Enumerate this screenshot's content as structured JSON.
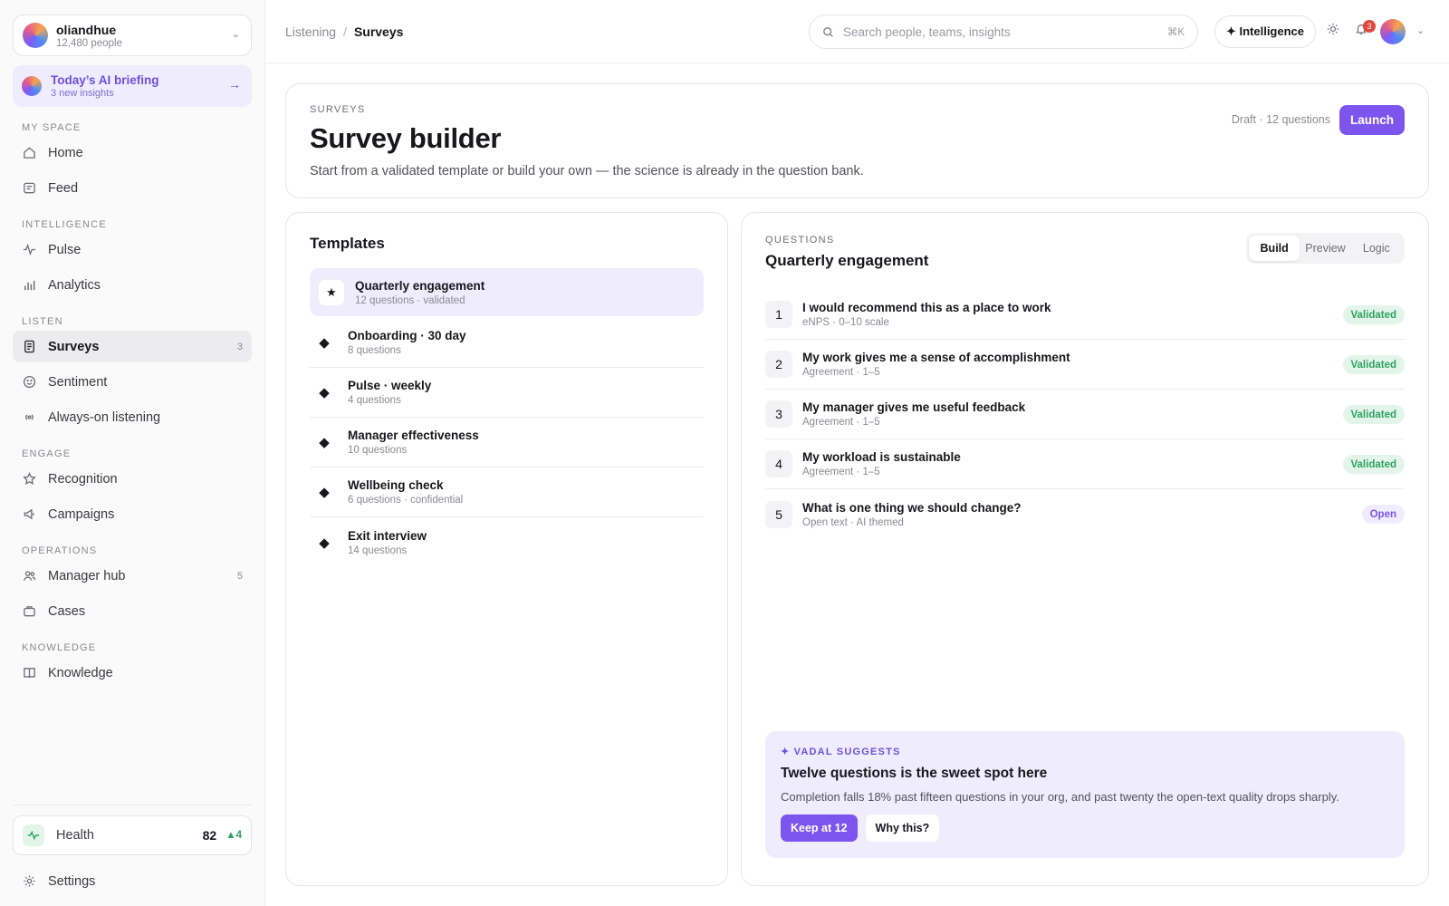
{
  "org": {
    "name": "oliandhue",
    "people": "12,480 people"
  },
  "briefing": {
    "title": "Today’s AI briefing",
    "subtitle": "3 new insights"
  },
  "sidebar": {
    "sections": {
      "myspace": "MY SPACE",
      "intelligence": "INTELLIGENCE",
      "listen": "LISTEN",
      "engage": "ENGAGE",
      "operations": "OPERATIONS",
      "knowledge": "KNOWLEDGE"
    },
    "items": {
      "home": "Home",
      "feed": "Feed",
      "pulse": "Pulse",
      "analytics": "Analytics",
      "surveys": "Surveys",
      "surveys_count": "3",
      "sentiment": "Sentiment",
      "always_on": "Always-on listening",
      "recognition": "Recognition",
      "campaigns": "Campaigns",
      "manager_hub": "Manager hub",
      "manager_hub_count": "5",
      "cases": "Cases",
      "knowledge": "Knowledge"
    },
    "health": {
      "label": "Health",
      "value": "82",
      "delta": "▲4"
    },
    "settings": "Settings"
  },
  "topbar": {
    "breadcrumb": {
      "parent": "Listening",
      "separator": "/",
      "current": "Surveys"
    },
    "search_placeholder": "Search people, teams, insights",
    "search_shortcut": "⌘K",
    "intelligence_button": "✦ Intelligence",
    "notification_count": "3"
  },
  "header": {
    "eyebrow": "SURVEYS",
    "title": "Survey builder",
    "description": "Start from a validated template or build your own — the science is already in the question bank.",
    "meta": "Draft · 12 questions",
    "launch": "Launch"
  },
  "templates": {
    "title": "Templates",
    "items": [
      {
        "icon": "★",
        "name": "Quarterly engagement",
        "sub": "12 questions · validated"
      },
      {
        "icon": "◆",
        "name": "Onboarding · 30 day",
        "sub": "8 questions"
      },
      {
        "icon": "◆",
        "name": "Pulse · weekly",
        "sub": "4 questions"
      },
      {
        "icon": "◆",
        "name": "Manager effectiveness",
        "sub": "10 questions"
      },
      {
        "icon": "◆",
        "name": "Wellbeing check",
        "sub": "6 questions · confidential"
      },
      {
        "icon": "◆",
        "name": "Exit interview",
        "sub": "14 questions"
      }
    ]
  },
  "questions": {
    "eyebrow": "QUESTIONS",
    "title": "Quarterly engagement",
    "tabs": [
      "Build",
      "Preview",
      "Logic"
    ],
    "items": [
      {
        "n": "1",
        "text": "I would recommend this as a place to work",
        "sub": "eNPS · 0–10 scale",
        "tag": "Validated"
      },
      {
        "n": "2",
        "text": "My work gives me a sense of accomplishment",
        "sub": "Agreement · 1–5",
        "tag": "Validated"
      },
      {
        "n": "3",
        "text": "My manager gives me useful feedback",
        "sub": "Agreement · 1–5",
        "tag": "Validated"
      },
      {
        "n": "4",
        "text": "My workload is sustainable",
        "sub": "Agreement · 1–5",
        "tag": "Validated"
      },
      {
        "n": "5",
        "text": "What is one thing we should change?",
        "sub": "Open text · AI themed",
        "tag": "Open"
      }
    ]
  },
  "suggestion": {
    "kicker": "✦ VADAL SUGGESTS",
    "title": "Twelve questions is the sweet spot here",
    "body": "Completion falls 18% past fifteen questions in your org, and past twenty the open-text quality drops sharply.",
    "primary": "Keep at 12",
    "secondary": "Why this?"
  },
  "colors": {
    "accent": "#7c55ef",
    "success": "#2ea263",
    "badge": "#e0483d"
  }
}
